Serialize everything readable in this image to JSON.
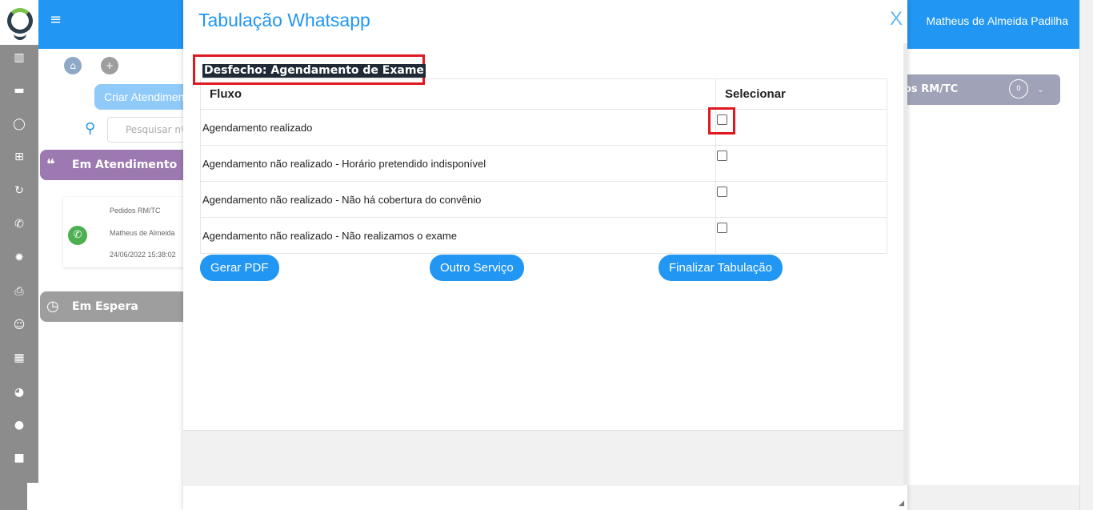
{
  "app": {
    "user_name": "Matheus de Almeida Padilha",
    "menu_icon": "hamburger-icon"
  },
  "sidebar": {
    "icons": [
      "chart-bar-icon",
      "briefcase-icon",
      "whatsapp-icon",
      "plus-square-icon",
      "refresh-icon",
      "phone-icon",
      "gear-icon",
      "print-icon",
      "smile-icon",
      "calendar-icon",
      "dashboard-icon",
      "comment-icon",
      "video-icon"
    ]
  },
  "background": {
    "criar_label": "Criar Atendimento",
    "search_placeholder": "Pesquisar nº",
    "em_atendimento_label": "Em Atendimento",
    "em_espera_label": "Em Espera",
    "card": {
      "line1": "Pedidos RM/TC",
      "line2": "Matheus de Almeida",
      "line3": "24/06/2022 15:38:02"
    },
    "rmtc_label": "os RM/TC",
    "rmtc_count": "0"
  },
  "modal": {
    "title": "Tabulação Whatsapp",
    "close_label": "X",
    "desfecho_label": "Desfecho: Agendamento de Exame",
    "table": {
      "col_fluxo": "Fluxo",
      "col_selecionar": "Selecionar",
      "rows": [
        {
          "label": "Agendamento realizado",
          "checked": false
        },
        {
          "label": "Agendamento não realizado - Horário pretendido indisponível",
          "checked": false
        },
        {
          "label": "Agendamento não realizado - Não há cobertura do convênio",
          "checked": false
        },
        {
          "label": "Agendamento não realizado - Não realizamos o exame",
          "checked": false
        }
      ]
    },
    "buttons": {
      "gerar_pdf": "Gerar PDF",
      "outro_servico": "Outro Serviço",
      "finalizar": "Finalizar Tabulação"
    }
  },
  "colors": {
    "primary": "#2196f3",
    "highlight_red": "#e0191f",
    "purple_section": "#9c7ab1"
  }
}
